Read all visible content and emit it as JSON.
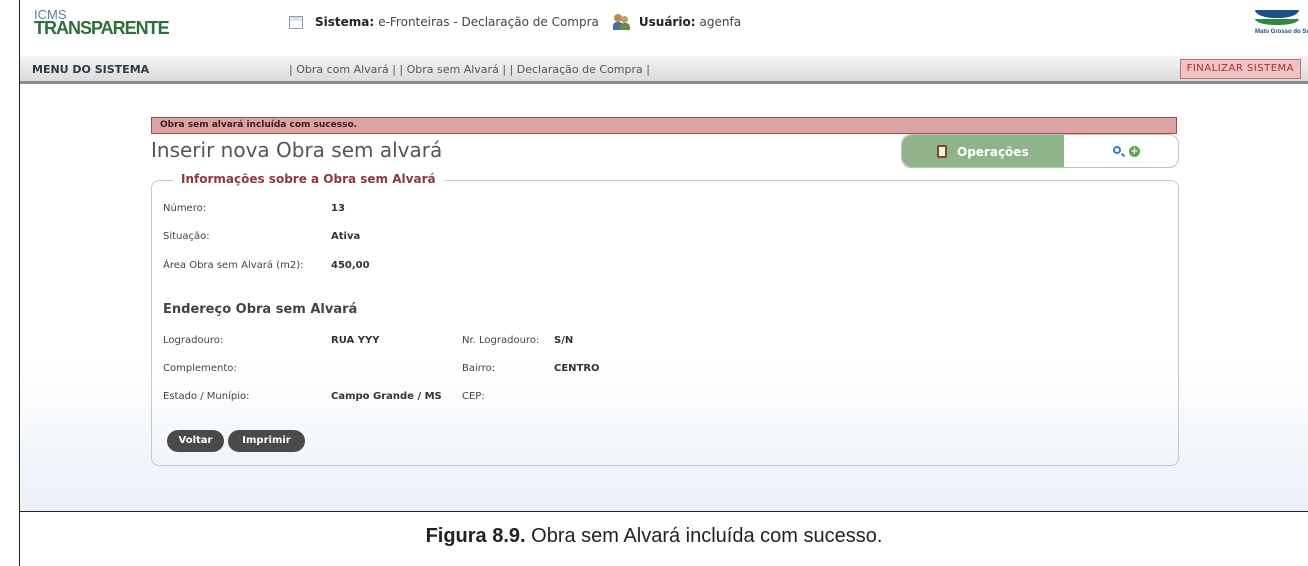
{
  "header": {
    "logo_line1": "ICMS",
    "logo_line2": "TRANSPARENTE",
    "system_label": "Sistema:",
    "system_value": "e-Fronteiras - Declaração de Compra",
    "user_label": "Usuário:",
    "user_value": "agenfa",
    "state_logo_text": "Mato Grosso do Sul"
  },
  "menu": {
    "title": "MENU DO SISTEMA",
    "links": [
      "Obra com Alvará",
      "Obra sem Alvará",
      "Declaração de Compra"
    ],
    "finalizar_label": "FINALIZAR SISTEMA"
  },
  "message": "Obra sem alvará incluída com sucesso.",
  "page_title": "Inserir nova Obra sem alvará",
  "operations": {
    "label": "Operações",
    "search_icon": "search-icon",
    "add_icon": "add-icon"
  },
  "panel": {
    "legend": "Informações sobre a Obra sem Alvará",
    "numero_label": "Número:",
    "numero_value": "13",
    "situacao_label": "Situação:",
    "situacao_value": "Ativa",
    "area_label": "Área Obra sem Alvará (m2):",
    "area_value": "450,00",
    "address_heading": "Endereço Obra sem Alvará",
    "logradouro_label": "Logradouro:",
    "logradouro_value": "RUA YYY",
    "nr_logradouro_label": "Nr. Logradouro:",
    "nr_logradouro_value": "S/N",
    "complemento_label": "Complemento:",
    "complemento_value": "",
    "bairro_label": "Bairro:",
    "bairro_value": "CENTRO",
    "estado_label": "Estado / Munípio:",
    "estado_value": "Campo Grande / MS",
    "cep_label": "CEP:",
    "cep_value": "",
    "voltar_label": "Voltar",
    "imprimir_label": "Imprimir"
  },
  "caption": {
    "figure": "Figura 8.9.",
    "text": "Obra sem Alvará incluída com sucesso."
  }
}
